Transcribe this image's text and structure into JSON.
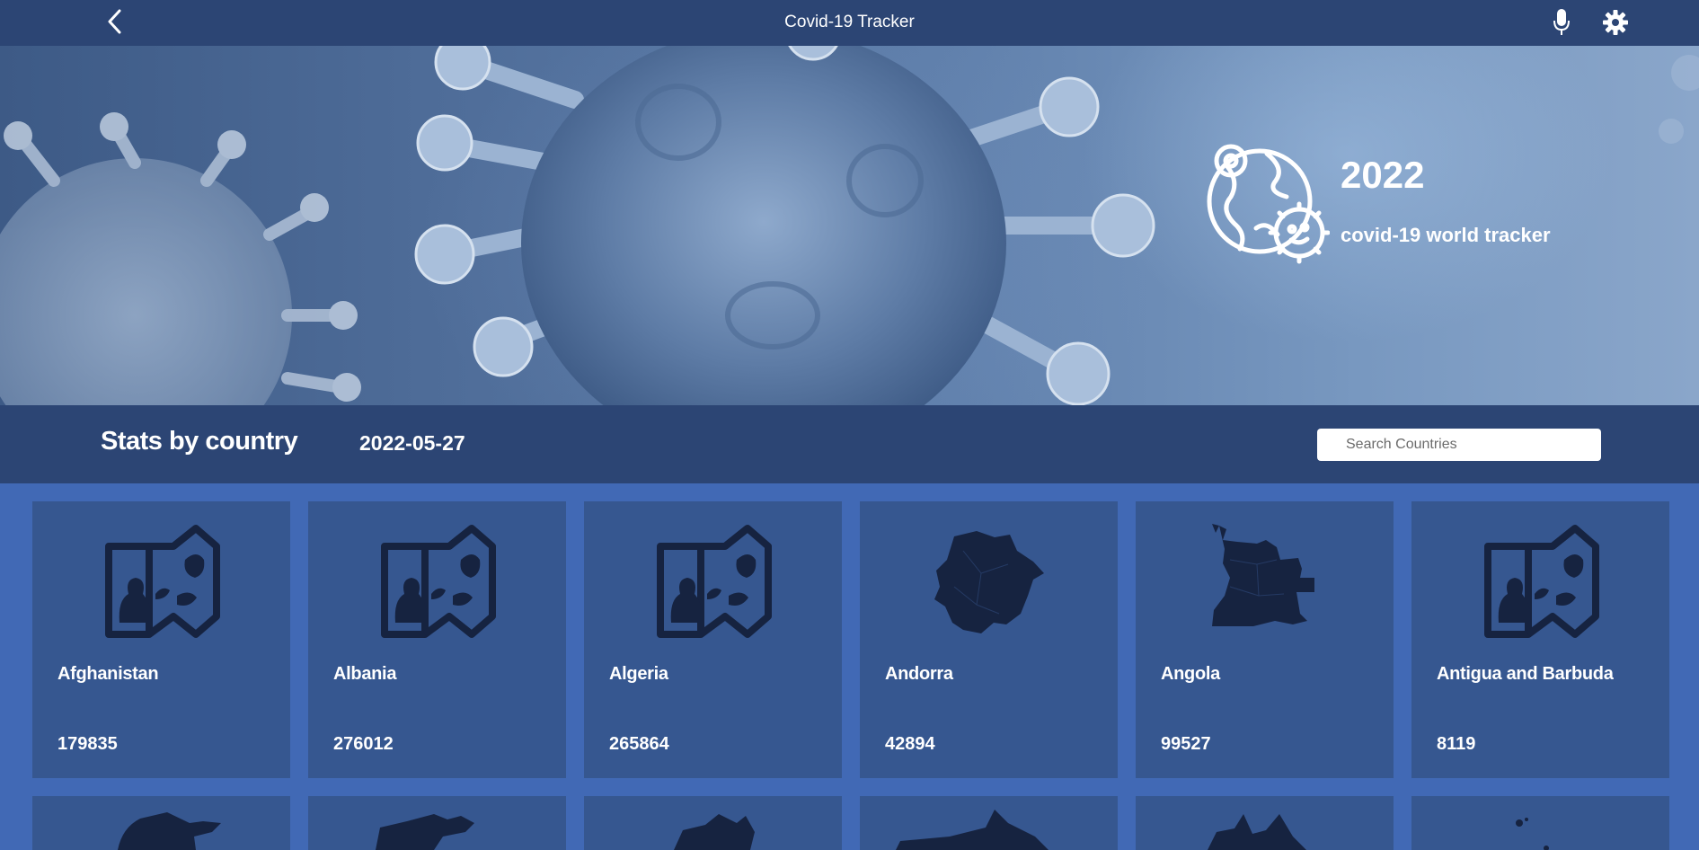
{
  "app": {
    "title": "Covid-19 Tracker"
  },
  "hero": {
    "year": "2022",
    "subtitle": "covid-19 world tracker"
  },
  "stats": {
    "title": "Stats by country",
    "date": "2022-05-27",
    "search_placeholder": "Search Countries"
  },
  "countries": [
    {
      "name": "Afghanistan",
      "count": "179835",
      "icon": "generic-map-icon"
    },
    {
      "name": "Albania",
      "count": "276012",
      "icon": "generic-map-icon"
    },
    {
      "name": "Algeria",
      "count": "265864",
      "icon": "generic-map-icon"
    },
    {
      "name": "Andorra",
      "count": "42894",
      "icon": "andorra-map-icon"
    },
    {
      "name": "Angola",
      "count": "99527",
      "icon": "angola-map-icon"
    },
    {
      "name": "Antigua and Barbuda",
      "count": "8119",
      "icon": "generic-map-icon"
    }
  ],
  "icons": {
    "back": "chevron-left-icon",
    "mic": "microphone-icon",
    "settings": "gear-icon",
    "emblem": "globe-virus-icon"
  },
  "colors": {
    "header": "#2c4574",
    "background": "#4169b5",
    "card": "#365790",
    "map_fill": "#162340"
  }
}
